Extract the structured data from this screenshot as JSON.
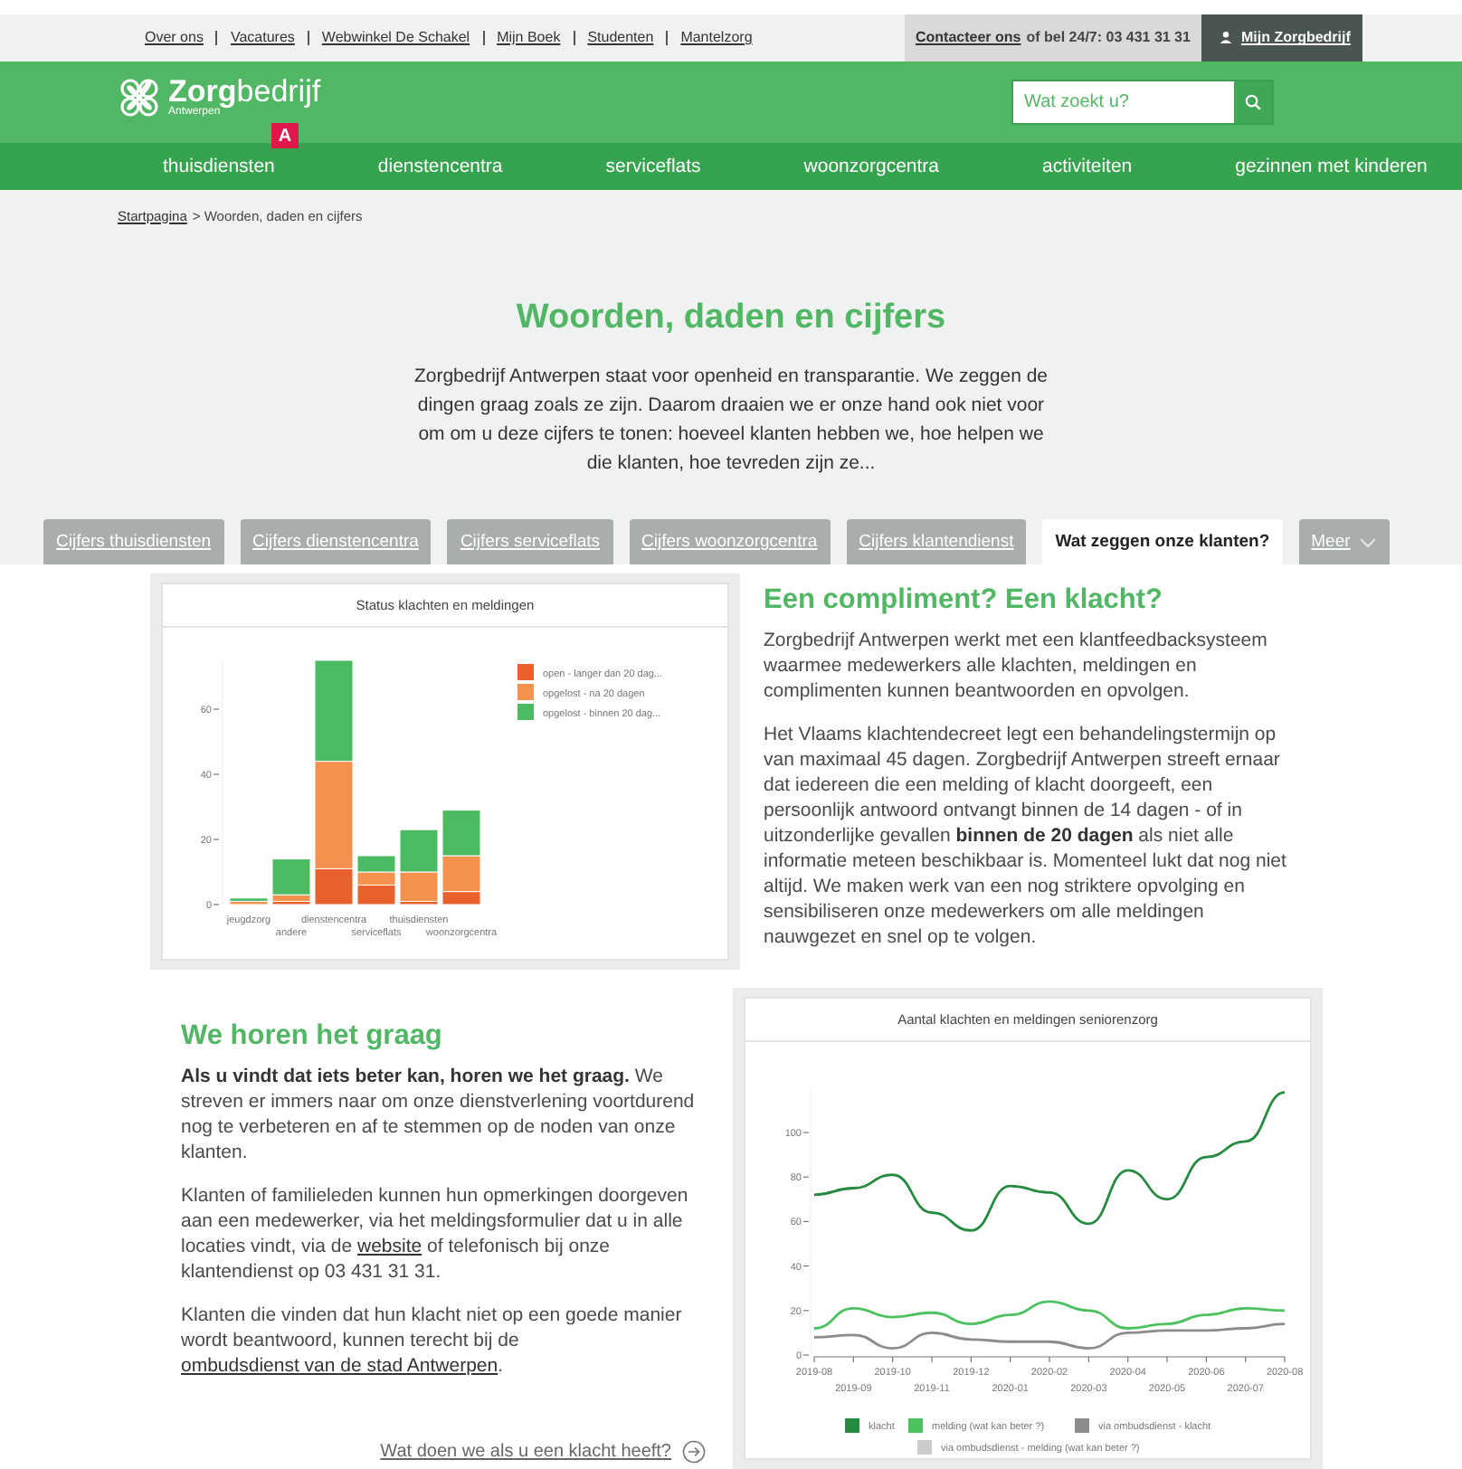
{
  "top_bar": {
    "links": [
      "Over ons",
      "Vacatures",
      "Webwinkel De Schakel",
      "Mijn Boek",
      "Studenten",
      "Mantelzorg"
    ],
    "contact": {
      "link": "Contacteer ons",
      "text": "of bel 24/7: 03 431 31 31"
    },
    "account": "Mijn Zorgbedrijf"
  },
  "header": {
    "logo": {
      "bold": "Zorg",
      "light": "bedrijf",
      "subtitle": "Antwerpen",
      "badge": "A"
    },
    "search": {
      "placeholder": "Wat zoekt u?"
    }
  },
  "nav": [
    "thuisdiensten",
    "dienstencentra",
    "serviceflats",
    "woonzorgcentra",
    "activiteiten",
    "gezinnen met kinderen"
  ],
  "breadcrumb": {
    "link": "Startpagina",
    "current": "> Woorden, daden en cijfers"
  },
  "title": "Woorden, daden en cijfers",
  "intro": "Zorgbedrijf Antwerpen staat voor openheid en transparantie. We zeggen de dingen graag zoals ze zijn. Daarom draaien we er onze hand ook niet voor om om u deze cijfers te tonen: hoeveel klanten hebben we, hoe helpen we die klanten, hoe tevreden zijn ze...",
  "tabs": [
    {
      "label": "Cijfers thuisdiensten",
      "selected": false,
      "kind": "tab"
    },
    {
      "label": "Cijfers dienstencentra",
      "selected": false,
      "kind": "tab"
    },
    {
      "label": "Cijfers serviceflats",
      "selected": false,
      "kind": "tab"
    },
    {
      "label": "Cijfers woonzorgcentra",
      "selected": false,
      "kind": "tab"
    },
    {
      "label": "Cijfers klantendienst",
      "selected": false,
      "kind": "tab"
    },
    {
      "label": "Wat zeggen onze klanten?",
      "selected": true,
      "kind": "tab"
    },
    {
      "label": "Meer",
      "selected": false,
      "kind": "dropdown"
    }
  ],
  "status_chart": {
    "chart_data": {
      "type": "bar",
      "stacked": true,
      "title": "Status klachten en meldingen",
      "categories": [
        "jeugdzorg",
        "andere",
        "dienstencentra",
        "serviceflats",
        "thuisdiensten",
        "woonzorgcentra"
      ],
      "yticks": [
        0,
        20,
        40,
        60
      ],
      "ylim": [
        0,
        75
      ],
      "legend": "right",
      "series": [
        {
          "name": "open - langer dan 20 dag...",
          "color": "#e8602c",
          "values": [
            0,
            1,
            11,
            6,
            1,
            4
          ]
        },
        {
          "name": "opgelost - na 20 dagen",
          "color": "#f5914f",
          "values": [
            1,
            2,
            33,
            4,
            9,
            11
          ]
        },
        {
          "name": "opgelost - binnen 20 dag...",
          "color": "#4cb963",
          "values": [
            1,
            11,
            31,
            5,
            13,
            14
          ]
        }
      ]
    }
  },
  "compliment": {
    "heading": "Een compliment? Een klacht?",
    "paragraphs": [
      "Zorgbedrijf Antwerpen werkt met een klantfeedbacksysteem waarmee medewerkers alle klachten, meldingen en complimenten kunnen beantwoorden en opvolgen.",
      "Het Vlaams klachtendecreet legt een behandelingstermijn op van maximaal 45 dagen. Zorgbedrijf Antwerpen streeft ernaar dat iedereen die een melding of klacht doorgeeft, een persoonlijk antwoord ontvangt binnen de 14 dagen - of in uitzonderlijke gevallen **binnen de 20 dagen** als niet alle informatie meteen beschikbaar is. Momenteel lukt dat nog niet altijd. We maken werk van een nog striktere opvolging en sensibiliseren onze medewerkers om alle meldingen nauwgezet en snel op te volgen."
    ]
  },
  "feedback": {
    "heading": "We horen het graag",
    "paragraphs": [
      {
        "text": "**Als u vindt dat iets beter kan, horen we het graag.** We streven er immers naar om onze dienstverlening voortdurend nog te verbeteren en af te stemmen op de noden van onze klanten."
      },
      {
        "text": "Klanten of familieleden kunnen hun opmerkingen doorgeven aan een medewerker, via het meldingsformulier dat u in alle locaties vindt, via de",
        "link": "website",
        "after": "of telefonisch bij onze klantendienst op 03 431 31 31."
      },
      {
        "text": "Klanten die vinden dat hun klacht niet op een goede manier wordt beantwoord, kunnen terecht bij de",
        "link": "ombudsdienst van de stad Antwerpen",
        "after": "."
      }
    ],
    "more_link": "Wat doen we als u een klacht heeft?"
  },
  "trend_chart": {
    "chart_data": {
      "type": "line",
      "title": "Aantal klachten en meldingen seniorenzorg",
      "x": [
        "2019-08",
        "2019-09",
        "2019-10",
        "2019-11",
        "2019-12",
        "2020-01",
        "2020-02",
        "2020-03",
        "2020-04",
        "2020-05",
        "2020-06",
        "2020-07",
        "2020-08"
      ],
      "yticks": [
        0,
        20,
        40,
        60,
        80,
        100
      ],
      "ylim": [
        0,
        120
      ],
      "legend": "bottom",
      "series": [
        {
          "name": "klacht",
          "color": "#268a3f",
          "values": [
            72,
            75,
            81,
            64,
            56,
            76,
            73,
            59,
            83,
            70,
            89,
            96,
            118
          ]
        },
        {
          "name": "melding (wat kan beter ?)",
          "color": "#4cc160",
          "values": [
            12,
            21,
            17,
            19,
            14,
            18,
            24,
            20,
            12,
            14,
            18,
            21,
            20
          ]
        },
        {
          "name": "via ombudsdienst - klacht",
          "color": "#8c8c8c",
          "values": [
            8,
            9,
            3,
            10,
            7,
            6,
            6,
            3,
            10,
            11,
            11,
            12,
            14
          ]
        },
        {
          "name": "via ombudsdienst - melding (wat kan beter ?)",
          "color": "#cccccc",
          "values": [
            null,
            null,
            null,
            null,
            null,
            null,
            null,
            null,
            null,
            null,
            null,
            null,
            null
          ]
        }
      ]
    }
  }
}
